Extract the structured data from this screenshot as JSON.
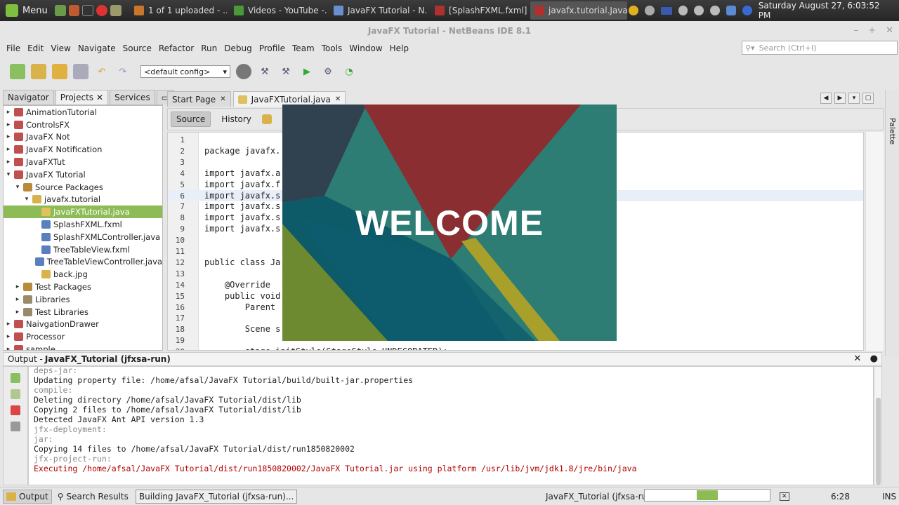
{
  "taskbar": {
    "menu_label": "Menu",
    "tasks": [
      {
        "label": "1 of 1 uploaded - ...",
        "color": "#c8772a",
        "active": false
      },
      {
        "label": "Videos - YouTube -...",
        "color": "#4a9a3a",
        "active": false
      },
      {
        "label": "JavaFX Tutorial - N...",
        "color": "#6a8fcf",
        "active": false
      },
      {
        "label": "[SplashFXML.fxml]",
        "color": "#b03030",
        "active": false
      },
      {
        "label": "javafx.tutorial.Java...",
        "color": "#b03030",
        "active": true
      }
    ],
    "clock": "Saturday August 27,  6:03:52 PM"
  },
  "window": {
    "title": "JavaFX Tutorial - NetBeans IDE 8.1"
  },
  "menubar": [
    "File",
    "Edit",
    "View",
    "Navigate",
    "Source",
    "Refactor",
    "Run",
    "Debug",
    "Profile",
    "Team",
    "Tools",
    "Window",
    "Help"
  ],
  "search": {
    "placeholder": "Search (Ctrl+I)"
  },
  "toolbar": {
    "config": "<default config>"
  },
  "left_tabs": [
    {
      "label": "Navigator",
      "closable": false
    },
    {
      "label": "Projects",
      "closable": true
    },
    {
      "label": "Services",
      "closable": false
    }
  ],
  "tree": [
    {
      "label": "AnimationTutorial",
      "depth": 0,
      "exp": "▸",
      "color": "#c0504d"
    },
    {
      "label": "ControlsFX",
      "depth": 0,
      "exp": "▸",
      "color": "#c0504d"
    },
    {
      "label": "JavaFX Not",
      "depth": 0,
      "exp": "▸",
      "color": "#c0504d"
    },
    {
      "label": "JavaFX Notification",
      "depth": 0,
      "exp": "▸",
      "color": "#c0504d"
    },
    {
      "label": "JavaFXTut",
      "depth": 0,
      "exp": "▸",
      "color": "#c0504d"
    },
    {
      "label": "JavaFX Tutorial",
      "depth": 0,
      "exp": "▾",
      "color": "#c0504d"
    },
    {
      "label": "Source Packages",
      "depth": 1,
      "exp": "▾",
      "color": "#b88a3a"
    },
    {
      "label": "javafx.tutorial",
      "depth": 2,
      "exp": "▾",
      "color": "#d9b24a"
    },
    {
      "label": "JavaFXTutorial.java",
      "depth": 3,
      "exp": "",
      "color": "#e0c060",
      "selected": true
    },
    {
      "label": "SplashFXML.fxml",
      "depth": 3,
      "exp": "",
      "color": "#5a7fbf"
    },
    {
      "label": "SplashFXMLController.java",
      "depth": 3,
      "exp": "",
      "color": "#5a7fbf"
    },
    {
      "label": "TreeTableView.fxml",
      "depth": 3,
      "exp": "",
      "color": "#5a7fbf"
    },
    {
      "label": "TreeTableViewController.java",
      "depth": 3,
      "exp": "",
      "color": "#5a7fbf"
    },
    {
      "label": "back.jpg",
      "depth": 3,
      "exp": "",
      "color": "#d9b24a"
    },
    {
      "label": "Test Packages",
      "depth": 1,
      "exp": "▸",
      "color": "#b88a3a"
    },
    {
      "label": "Libraries",
      "depth": 1,
      "exp": "▸",
      "color": "#9a8a6a"
    },
    {
      "label": "Test Libraries",
      "depth": 1,
      "exp": "▸",
      "color": "#9a8a6a"
    },
    {
      "label": "NaivgationDrawer",
      "depth": 0,
      "exp": "▸",
      "color": "#c0504d"
    },
    {
      "label": "Processor",
      "depth": 0,
      "exp": "▸",
      "color": "#c0504d"
    },
    {
      "label": "sample",
      "depth": 0,
      "exp": "▸",
      "color": "#c0504d"
    }
  ],
  "editor_tabs": [
    {
      "label": "Start Page",
      "selected": false
    },
    {
      "label": "JavaFXTutorial.java",
      "selected": true
    }
  ],
  "editor_tools": {
    "source": "Source",
    "history": "History"
  },
  "code_lines": [
    {
      "n": "1",
      "t": ""
    },
    {
      "n": "2",
      "t": "package javafx."
    },
    {
      "n": "3",
      "t": ""
    },
    {
      "n": "4",
      "t": "import javafx.a"
    },
    {
      "n": "5",
      "t": "import javafx.f"
    },
    {
      "n": "6",
      "t": "import javafx.s",
      "hl": true
    },
    {
      "n": "7",
      "t": "import javafx.s"
    },
    {
      "n": "8",
      "t": "import javafx.s"
    },
    {
      "n": "9",
      "t": "import javafx.s"
    },
    {
      "n": "10",
      "t": ""
    },
    {
      "n": "11",
      "t": ""
    },
    {
      "n": "12",
      "t": "public class Ja"
    },
    {
      "n": "13",
      "t": ""
    },
    {
      "n": "14",
      "t": "    @Override"
    },
    {
      "n": "15",
      "t": "    public void"
    },
    {
      "n": "16",
      "t": "        Parent                                                            ));"
    },
    {
      "n": "17",
      "t": ""
    },
    {
      "n": "18",
      "t": "        Scene s"
    },
    {
      "n": "19",
      "t": ""
    },
    {
      "n": "20",
      "t": "        stage.initStyle(StageStyle.UNDECORATED);"
    }
  ],
  "splash": {
    "text": "WELCOME"
  },
  "output": {
    "title_prefix": "Output - ",
    "title": "JavaFX_Tutorial (jfxsa-run)",
    "lines": [
      {
        "t": "deps-jar:",
        "c": "grey"
      },
      {
        "t": "Updating property file: /home/afsal/JavaFX Tutorial/build/built-jar.properties",
        "c": ""
      },
      {
        "t": "compile:",
        "c": "grey"
      },
      {
        "t": "Deleting directory /home/afsal/JavaFX Tutorial/dist/lib",
        "c": ""
      },
      {
        "t": "Copying 2 files to /home/afsal/JavaFX Tutorial/dist/lib",
        "c": ""
      },
      {
        "t": "Detected JavaFX Ant API version 1.3",
        "c": ""
      },
      {
        "t": "jfx-deployment:",
        "c": "grey"
      },
      {
        "t": "jar:",
        "c": "grey"
      },
      {
        "t": "Copying 14 files to /home/afsal/JavaFX Tutorial/dist/run1850820002",
        "c": ""
      },
      {
        "t": "jfx-project-run:",
        "c": "grey"
      },
      {
        "t": "Executing /home/afsal/JavaFX Tutorial/dist/run1850820002/JavaFX Tutorial.jar using platform /usr/lib/jvm/jdk1.8/jre/bin/java",
        "c": "red"
      }
    ]
  },
  "statusbar": {
    "output_tab": "Output",
    "search_results": "Search Results",
    "building": "Building JavaFX_Tutorial (jfxsa-run)...",
    "run_label": "JavaFX_Tutorial (jfxsa-run)",
    "position": "6:28",
    "mode": "INS"
  }
}
